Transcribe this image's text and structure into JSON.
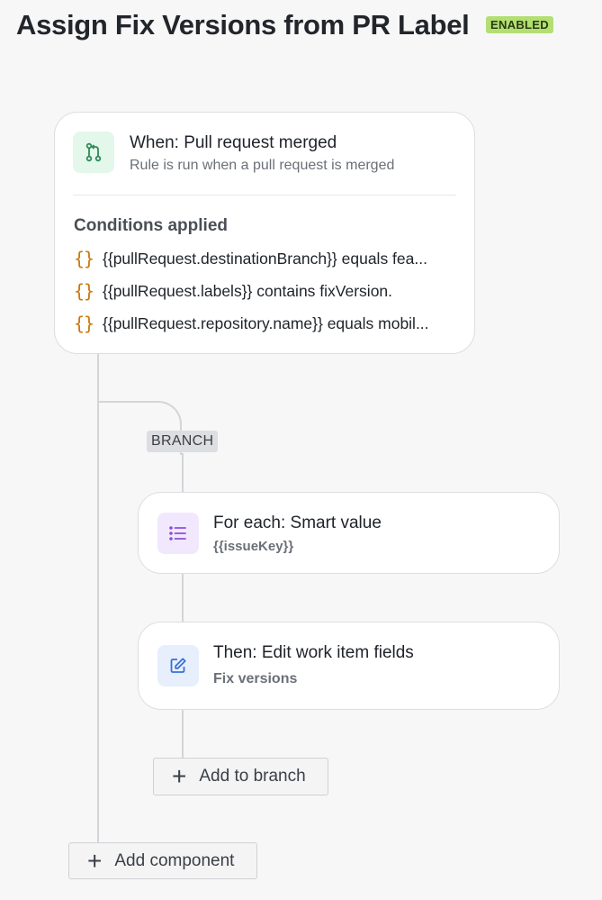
{
  "header": {
    "title": "Assign Fix Versions from PR Label",
    "status_badge": "ENABLED"
  },
  "trigger": {
    "icon": "pull-request-icon",
    "title": "When: Pull request merged",
    "description": "Rule is run when a pull request is merged",
    "conditions_title": "Conditions applied",
    "conditions": [
      {
        "icon": "smart-value-icon",
        "text": "{{pullRequest.destinationBranch}} equals fea..."
      },
      {
        "icon": "smart-value-icon",
        "text": "{{pullRequest.labels}} contains fixVersion."
      },
      {
        "icon": "smart-value-icon",
        "text": "{{pullRequest.repository.name}} equals mobil..."
      }
    ]
  },
  "branch": {
    "label": "BRANCH",
    "for_each": {
      "icon": "list-icon",
      "title": "For each: Smart value",
      "value": "{{issueKey}}"
    },
    "action": {
      "icon": "edit-icon",
      "title": "Then: Edit work item fields",
      "value": "Fix versions"
    },
    "add_button": "Add to branch"
  },
  "add_component_button": "Add component",
  "colors": {
    "badge": "#b3df72",
    "trigger_icon_bg": "#e3f7ea",
    "foreach_icon_bg": "#f1e8fd",
    "action_icon_bg": "#e7effd",
    "brace": "#c97a12"
  }
}
